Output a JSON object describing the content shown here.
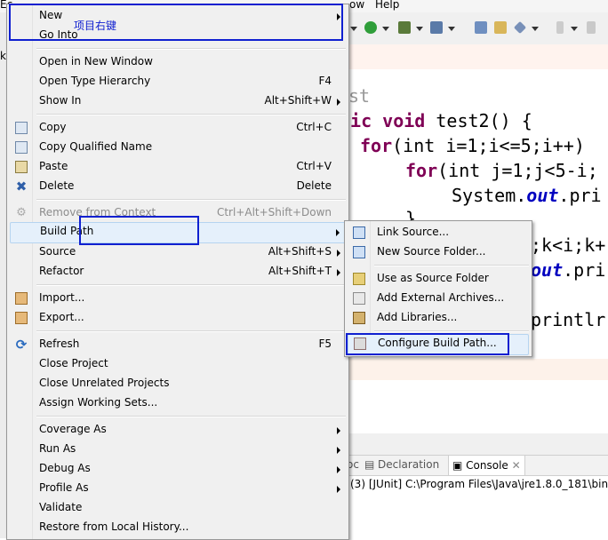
{
  "background": {
    "menubar": {
      "left_fragment": "Ec",
      "right_fragment": "ow",
      "help": "Help"
    },
    "left_fragment": "k",
    "code_lines": [
      {
        "text": "st",
        "kind": "plain"
      },
      {
        "kw": "lic void",
        "rest": " test2() {"
      },
      {
        "kw": "for",
        "rest": "(int i=1;i<=5;i++)"
      },
      {
        "kw": "for",
        "rest": "(int j=1;j<5-i;"
      },
      {
        "pre": "System.",
        "fld": "out",
        "post": ".pri"
      },
      {
        "text": "}",
        "kind": "plain"
      },
      {
        "text": ";k<i;k+",
        "kind": "plain"
      },
      {
        "fld": "out",
        "post": ".pri"
      },
      {
        "text": "printlr",
        "kind": "plain"
      }
    ],
    "views_tabs": {
      "javadoc_fragment": "oc",
      "declaration": "Declaration",
      "console": "Console"
    },
    "console_line": "(3) [JUnit] C:\\Program Files\\Java\\jre1.8.0_181\\bin\\ja"
  },
  "context_menu": {
    "items": [
      {
        "label": "New",
        "accel": "",
        "submenu": true
      },
      {
        "label": "Go Into",
        "accel": ""
      },
      {
        "label": "Open in New Window",
        "accel": ""
      },
      {
        "label": "Open Type Hierarchy",
        "accel": "F4"
      },
      {
        "label": "Show In",
        "accel": "Alt+Shift+W",
        "submenu": true
      },
      {
        "label": "Copy",
        "accel": "Ctrl+C"
      },
      {
        "label": "Copy Qualified Name",
        "accel": ""
      },
      {
        "label": "Paste",
        "accel": "Ctrl+V"
      },
      {
        "label": "Delete",
        "accel": "Delete"
      },
      {
        "label": "Remove from Context",
        "accel": "Ctrl+Alt+Shift+Down"
      },
      {
        "label": "Build Path",
        "accel": "",
        "submenu": true
      },
      {
        "label": "Source",
        "accel": "Alt+Shift+S",
        "submenu": true
      },
      {
        "label": "Refactor",
        "accel": "Alt+Shift+T",
        "submenu": true
      },
      {
        "label": "Import...",
        "accel": ""
      },
      {
        "label": "Export...",
        "accel": ""
      },
      {
        "label": "Refresh",
        "accel": "F5"
      },
      {
        "label": "Close Project",
        "accel": ""
      },
      {
        "label": "Close Unrelated Projects",
        "accel": ""
      },
      {
        "label": "Assign Working Sets...",
        "accel": ""
      },
      {
        "label": "Coverage As",
        "accel": "",
        "submenu": true
      },
      {
        "label": "Run As",
        "accel": "",
        "submenu": true
      },
      {
        "label": "Debug As",
        "accel": "",
        "submenu": true
      },
      {
        "label": "Profile As",
        "accel": "",
        "submenu": true
      },
      {
        "label": "Validate",
        "accel": ""
      },
      {
        "label": "Restore from Local History...",
        "accel": ""
      }
    ]
  },
  "build_path_submenu": {
    "items": [
      {
        "label": "Link Source..."
      },
      {
        "label": "New Source Folder..."
      },
      {
        "label": "Use as Source Folder"
      },
      {
        "label": "Add External Archives..."
      },
      {
        "label": "Add Libraries..."
      },
      {
        "label": "Configure Build Path..."
      }
    ]
  },
  "annotation": {
    "text": "项目右键",
    "color": "#1020d0"
  }
}
